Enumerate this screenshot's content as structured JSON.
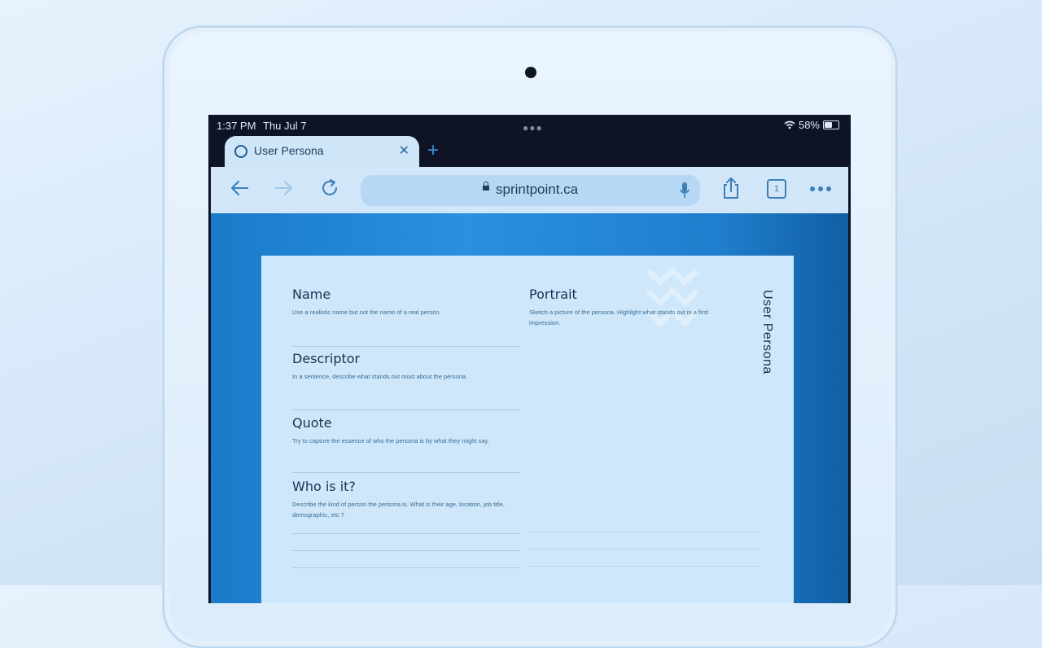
{
  "status": {
    "time": "1:37 PM",
    "date": "Thu Jul 7",
    "battery": "58%"
  },
  "tab": {
    "title": "User Persona"
  },
  "address_bar": {
    "url": "sprintpoint.ca"
  },
  "toolbar": {
    "tab_count": "1"
  },
  "document": {
    "vertical_title": "User Persona",
    "fields": [
      {
        "title": "Name",
        "description": "Use a realistic name but not the name of a real person."
      },
      {
        "title": "Descriptor",
        "description": "In a sentence, describe what stands out most about the persona."
      },
      {
        "title": "Quote",
        "description": "Try to capture the essence of who the persona is by what they might say."
      },
      {
        "title": "Who is it?",
        "description": "Describe the kind of person the persona is. What is their age, location, job title, demographic, etc.?"
      }
    ],
    "portrait": {
      "title": "Portrait",
      "description": "Sketch a picture of the persona. Highlight what stands out in a first impression."
    }
  },
  "colors": {
    "accent": "#3d90d6",
    "browser_chrome": "#d1e6f9",
    "page_bg": "#1a7bc9"
  }
}
